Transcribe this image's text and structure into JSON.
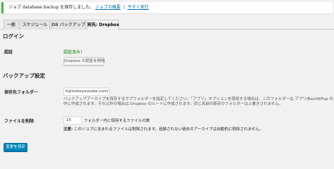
{
  "notice": {
    "message": "ジョブ database backup を保存しました。",
    "link_overview": "ジョブの概要",
    "separator": "|",
    "link_run_now": "今すぐ実行",
    "accent_color": "#46b450"
  },
  "tabs": [
    {
      "label": "一般"
    },
    {
      "label": "スケジュール"
    },
    {
      "label": "DB バックアップ"
    },
    {
      "label": "宛先: Dropbox"
    }
  ],
  "login": {
    "heading": "ログイン",
    "auth_label": "認証",
    "auth_status": "認証済み！",
    "delete_auth_button": "Dropbox の認証を削除"
  },
  "backup_settings": {
    "heading": "バックアップ設定",
    "folder_label": "保存先フォルダー",
    "folder_value": "fujimotoyousuke.com/",
    "folder_desc_1": "バックアップアーカイブを保存するサブフォルダーを指定してください。「アプリ」オプションを使用する場合は、このフォルダーは アプリ/BackWPup の",
    "folder_desc_2": "中に作成されます。それ以外の場合は Dropbox のルートに作成されます。同じ名前の既存のフォルダーは上書きされません。",
    "delete_label": "ファイルを削除",
    "delete_value": "15",
    "delete_suffix": "フォルダー内に保持するファイルの数",
    "note_bold": "注意:",
    "note_text": " このジョブに含まれるファイルは削除されます。追跡されない過去のアーカイブは自動的に削除されません。"
  },
  "save_button": "変更を保存",
  "colors": {
    "primary_button": "#0085ba",
    "link": "#0073aa",
    "auth_status": "#008000"
  }
}
